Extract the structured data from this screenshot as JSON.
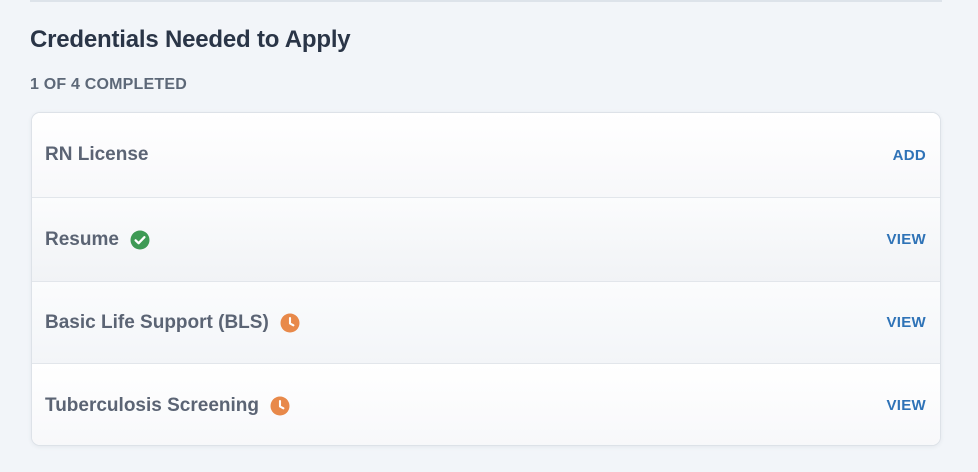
{
  "section": {
    "title": "Credentials Needed to Apply",
    "progress_label": "1 OF 4 COMPLETED"
  },
  "credentials": [
    {
      "name": "RN License",
      "status": "missing",
      "action": "ADD"
    },
    {
      "name": "Resume",
      "status": "completed",
      "status_icon": "check-circle-icon",
      "action": "VIEW"
    },
    {
      "name": "Basic Life Support (BLS)",
      "status": "pending",
      "status_icon": "clock-icon",
      "action": "VIEW"
    },
    {
      "name": "Tuberculosis Screening",
      "status": "pending",
      "status_icon": "clock-icon",
      "action": "VIEW"
    }
  ],
  "colors": {
    "completed": "#3e9a55",
    "pending": "#e8894a",
    "action_link": "#2f73b7"
  }
}
